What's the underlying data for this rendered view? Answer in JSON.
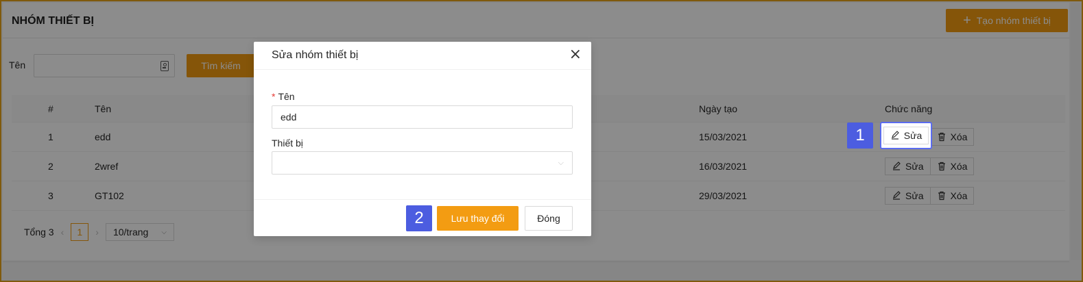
{
  "page": {
    "title": "NHÓM THIẾT BỊ",
    "create_label": "Tạo nhóm thiết bị"
  },
  "filter": {
    "label": "Tên",
    "value": "",
    "search_label": "Tìm kiếm"
  },
  "table": {
    "columns": [
      "#",
      "Tên",
      "Ngày tạo",
      "Chức năng"
    ],
    "rows": [
      {
        "index": "1",
        "name": "edd",
        "created": "15/03/2021"
      },
      {
        "index": "2",
        "name": "2wref",
        "created": "16/03/2021"
      },
      {
        "index": "3",
        "name": "GT102",
        "created": "29/03/2021"
      }
    ],
    "edit_label": "Sửa",
    "delete_label": "Xóa"
  },
  "pagination": {
    "total": "Tổng 3",
    "current_page": "1",
    "page_size": "10/trang"
  },
  "modal": {
    "title": "Sửa nhóm thiết bị",
    "name_label": "Tên",
    "name_value": "edd",
    "device_label": "Thiết bị",
    "device_value": "",
    "save_label": "Lưu thay đổi",
    "close_label": "Đóng"
  },
  "annotations": {
    "step1": "1",
    "step2": "2"
  },
  "colors": {
    "accent": "#f39c12",
    "badge": "#4c5de0",
    "frame": "#e8a317"
  }
}
